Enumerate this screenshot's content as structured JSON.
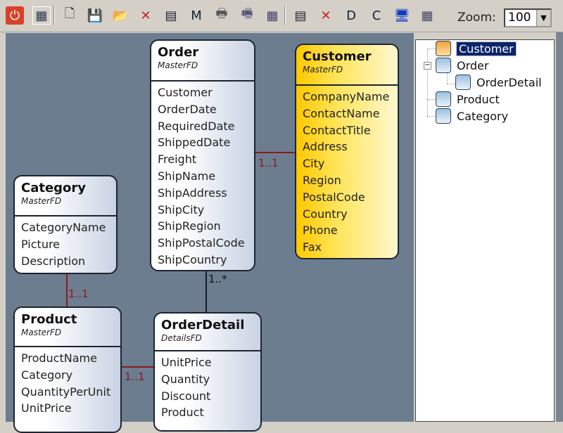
{
  "toolbar": {
    "buttons": [
      {
        "icon": "stop-icon",
        "glyph": "⏻",
        "color": "#d9412b"
      },
      {
        "icon": "diagram-view-icon",
        "glyph": "▦",
        "color": "#2a3a50"
      },
      {
        "icon": "new-file-icon",
        "glyph": "🗋",
        "color": "#222"
      },
      {
        "icon": "save-icon",
        "glyph": "💾",
        "color": "#1a1a60"
      },
      {
        "icon": "open-folder-icon",
        "glyph": "📂",
        "color": "#e0b020"
      },
      {
        "icon": "delete-icon",
        "glyph": "✕",
        "color": "#d02020"
      },
      {
        "icon": "properties-icon",
        "glyph": "▤",
        "color": "#223"
      },
      {
        "icon": "add-master-icon",
        "glyph": "M",
        "color": "#123"
      },
      {
        "icon": "print-icon",
        "glyph": "🖶",
        "color": "#555"
      },
      {
        "icon": "print-preview-icon",
        "glyph": "🖷",
        "color": "#557"
      },
      {
        "icon": "fields-icon",
        "glyph": "▦",
        "color": "#446"
      },
      {
        "icon": "properties-icon-2",
        "glyph": "▤",
        "color": "#223"
      },
      {
        "icon": "delete-icon-2",
        "glyph": "✕",
        "color": "#d02020"
      },
      {
        "icon": "add-detail-icon",
        "glyph": "D",
        "color": "#123"
      },
      {
        "icon": "add-child-icon",
        "glyph": "C",
        "color": "#123"
      },
      {
        "icon": "preview-icon",
        "glyph": "🖥",
        "color": "#1040c0"
      },
      {
        "icon": "fields-icon-2",
        "glyph": "▦",
        "color": "#446"
      }
    ],
    "zoom_label": "Zoom:",
    "zoom_value": "100"
  },
  "entities": [
    {
      "id": "order",
      "name": "Order",
      "stereotype": "MasterFD",
      "selected": false,
      "fields": [
        "Customer",
        "OrderDate",
        "RequiredDate",
        "ShippedDate",
        "Freight",
        "ShipName",
        "ShipAddress",
        "ShipCity",
        "ShipRegion",
        "ShipPostalCode",
        "ShipCountry"
      ]
    },
    {
      "id": "customer",
      "name": "Customer",
      "stereotype": "MasterFD",
      "selected": true,
      "fields": [
        "CompanyName",
        "ContactName",
        "ContactTitle",
        "Address",
        "City",
        "Region",
        "PostalCode",
        "Country",
        "Phone",
        "Fax"
      ]
    },
    {
      "id": "category",
      "name": "Category",
      "stereotype": "MasterFD",
      "selected": false,
      "fields": [
        "CategoryName",
        "Picture",
        "Description"
      ]
    },
    {
      "id": "product",
      "name": "Product",
      "stereotype": "MasterFD",
      "selected": false,
      "fields": [
        "ProductName",
        "Category",
        "QuantityPerUnit",
        "UnitPrice"
      ]
    },
    {
      "id": "orderdetail",
      "name": "OrderDetail",
      "stereotype": "DetailsFD",
      "selected": false,
      "fields": [
        "UnitPrice",
        "Quantity",
        "Discount",
        "Product"
      ]
    }
  ],
  "relations": [
    {
      "from": "Order",
      "to": "Customer",
      "label": "1..1",
      "color": "#8b1a1a"
    },
    {
      "from": "Order",
      "to": "OrderDetail",
      "label": "1..*",
      "color": "#1a1a1a"
    },
    {
      "from": "Category",
      "to": "Product",
      "label": "1..1",
      "color": "#8b1a1a"
    },
    {
      "from": "Product",
      "to": "OrderDetail",
      "label": "1..1",
      "color": "#8b1a1a"
    }
  ],
  "tree": [
    {
      "label": "Customer",
      "selected": true
    },
    {
      "label": "Order",
      "expanded": true
    },
    {
      "label": "OrderDetail"
    },
    {
      "label": "Product"
    },
    {
      "label": "Category"
    }
  ]
}
